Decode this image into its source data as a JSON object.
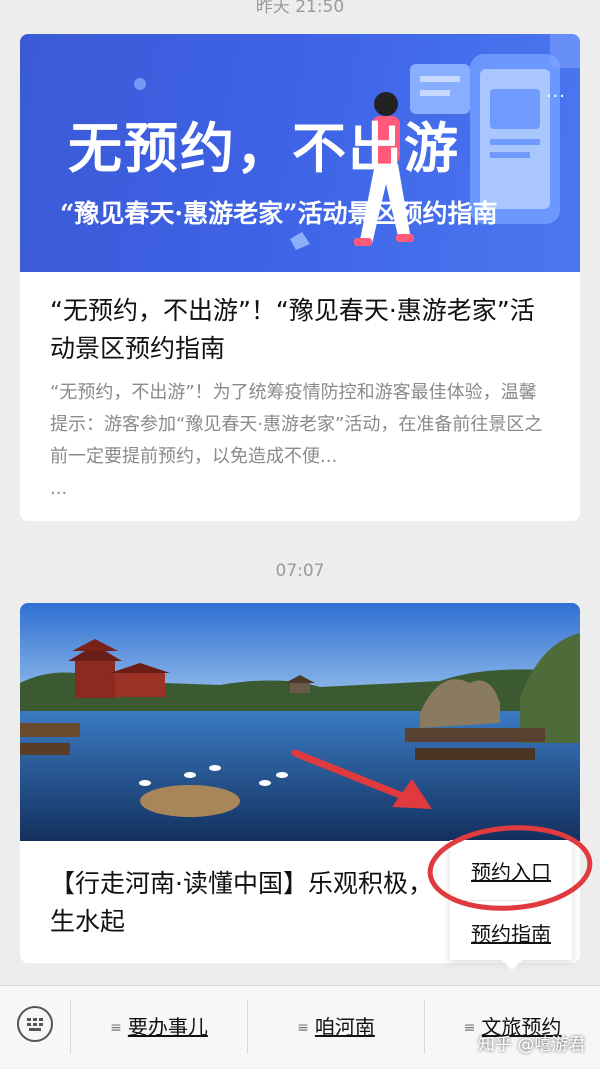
{
  "timestamps": [
    "昨天 21:50",
    "07:07"
  ],
  "article1": {
    "banner_headline": "无预约，不出游",
    "banner_subtitle": "“豫见春天·惠游老家”活动景区预约指南",
    "title": "“无预约，不出游”！“豫见春天·惠游老家”活动景区预约指南",
    "digest": "“无预约，不出游”！为了统筹疫情防控和游客最佳体验，温馨提示：游客参加“豫见春天·惠游老家”活动，在准备前往景区之前一定要提前预约，以免造成不便...",
    "digest_more": "..."
  },
  "article2": {
    "title": "【行走河南·读懂中国】乐观积极，生水起"
  },
  "popup_menu": {
    "items": [
      "预约入口",
      "预约指南"
    ],
    "highlight_color": "#e03a3e"
  },
  "bottom_menu": {
    "items": [
      "要办事儿",
      "咱河南",
      "文旅预约"
    ]
  },
  "watermark": "知乎 @嘻游君",
  "colors": {
    "accent_red": "#e03a3e",
    "banner_blue": "#3e62e6"
  }
}
